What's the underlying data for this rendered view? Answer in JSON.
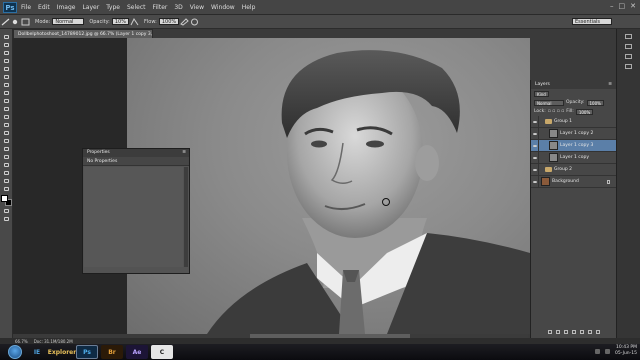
{
  "app": {
    "logo": "Ps"
  },
  "menu": [
    "File",
    "Edit",
    "Image",
    "Layer",
    "Type",
    "Select",
    "Filter",
    "3D",
    "View",
    "Window",
    "Help"
  ],
  "options_bar": {
    "mode_label": "Mode:",
    "mode_value": "Normal",
    "opacity_label": "Opacity:",
    "opacity_value": "10%",
    "flow_label": "Flow:",
    "flow_value": "100%",
    "workspace": "Essentials"
  },
  "document_tab": "Dollbelphotoshoot_14789012.jpg @ 66.7% (Layer 1 copy 3, RGB/16) *",
  "properties_panel": {
    "title": "Properties",
    "content": "No Properties"
  },
  "layers_panel": {
    "tab": "Layers",
    "kind": "Kind",
    "blend": "Normal",
    "opacity_label": "Opacity:",
    "opacity_value": "100%",
    "lock_label": "Lock:",
    "fill_label": "Fill:",
    "fill_value": "100%",
    "layers": [
      {
        "name": "Group 1",
        "type": "group"
      },
      {
        "name": "Layer 1 copy 2",
        "type": "layer"
      },
      {
        "name": "Layer 1 copy 3",
        "type": "layer",
        "selected": true
      },
      {
        "name": "Layer 1 copy",
        "type": "layer"
      },
      {
        "name": "Group 2",
        "type": "group"
      },
      {
        "name": "Background",
        "type": "background"
      }
    ]
  },
  "status": {
    "zoom": "66.7%",
    "doc": "Doc: 31.1M/180.2M"
  },
  "taskbar": {
    "items": [
      "IE",
      "Explorer",
      "Ps",
      "Br",
      "Ae",
      "C"
    ],
    "time": "10:43 PM",
    "date": "05-Jun-15"
  },
  "colors": {
    "accent_selected": "#5b7fa8",
    "ui_dark": "#3a3a3a"
  }
}
